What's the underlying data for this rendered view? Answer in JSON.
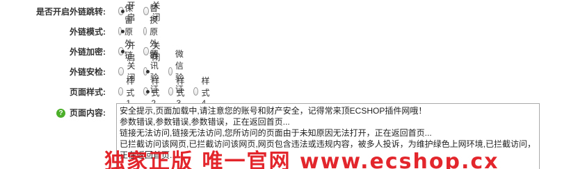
{
  "fields": [
    {
      "label": "是否开启外链跳转:",
      "options": [
        {
          "text": "开启",
          "checked": true
        },
        {
          "text": "关闭",
          "checked": false
        }
      ]
    },
    {
      "label": "外链模式:",
      "options": [
        {
          "text": "保留原外链",
          "checked": true
        },
        {
          "text": "替换原外链",
          "checked": false
        }
      ]
    },
    {
      "label": "外链加密:",
      "options": [
        {
          "text": "开启",
          "checked": true
        },
        {
          "text": "关闭",
          "checked": false
        }
      ]
    },
    {
      "label": "外链安检:",
      "options": [
        {
          "text": "关闭",
          "checked": false
        },
        {
          "text": "腾讯验证",
          "checked": true
        },
        {
          "text": "微信验证",
          "checked": false
        }
      ]
    },
    {
      "label": "页面样式:",
      "options": [
        {
          "text": "样式1",
          "checked": false
        },
        {
          "text": "样式2",
          "checked": true
        },
        {
          "text": "样式3",
          "checked": false
        },
        {
          "text": "样式4",
          "checked": false
        }
      ]
    }
  ],
  "content_label": "页面内容:",
  "help_icon": "question-icon",
  "content_text": "安全提示,页面加载中,请注意您的账号和财产安全，记得常来顶ECSHOP插件网哦！\n参数错误,参数错误,参数错误，正在返回首页...\n链接无法访问,链接无法访问,您所访问的页面由于未知原因无法打开，正在返回首页...\n已拦截访问该网页,已拦截访问该网页,网页包含违法或违规内容，被多人投诉，为维护绿色上网环境,已拦截访问，正在返回首页...",
  "watermark": "独家正版 唯一官网 www.ecshop.cx",
  "colors": {
    "watermark": "#e0141b",
    "help_icon": "#4caf2a"
  }
}
